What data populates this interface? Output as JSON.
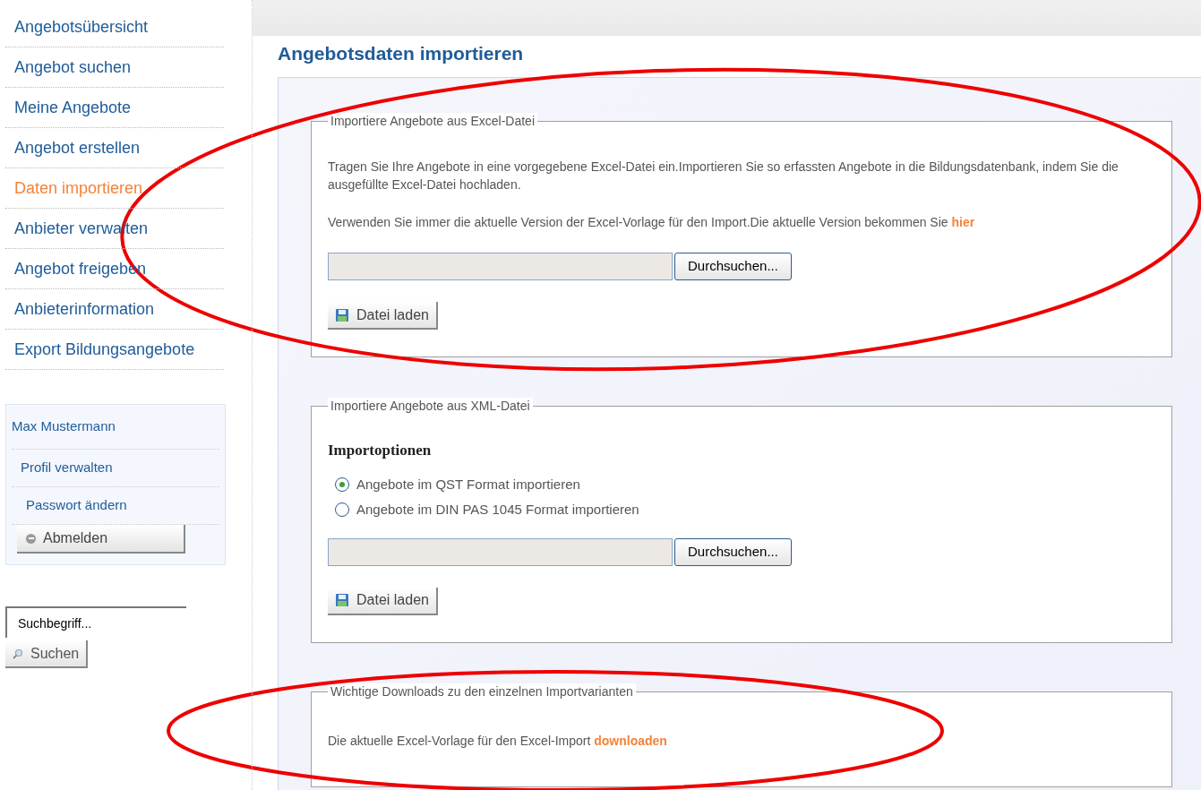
{
  "sidebar": {
    "nav": [
      {
        "label": "Angebotsübersicht",
        "selected": false
      },
      {
        "label": "Angebot suchen",
        "selected": false
      },
      {
        "label": "Meine Angebote",
        "selected": false
      },
      {
        "label": "Angebot erstellen",
        "selected": false
      },
      {
        "label": "Daten importieren",
        "selected": true
      },
      {
        "label": "Anbieter verwalten",
        "selected": false
      },
      {
        "label": "Angebot freigeben",
        "selected": false
      },
      {
        "label": "Anbieterinformation",
        "selected": false
      },
      {
        "label": "Export Bildungsangebote",
        "selected": false
      }
    ],
    "user_box": {
      "name": "Max Mustermann",
      "links": [
        "Profil verwalten",
        "Passwort ändern"
      ],
      "logout_button": "Abmelden"
    },
    "search": {
      "value": "Suchbegriff...",
      "button": "Suchen"
    }
  },
  "main": {
    "title": "Angebotsdaten importieren",
    "excel_import": {
      "legend": "Importiere Angebote aus Excel-Datei",
      "paragraph": "Tragen Sie Ihre Angebote in eine vorgegebene Excel-Datei ein.Importieren Sie so erfassten Angebote in die Bildungsdatenbank, indem Sie die ausgefüllte Excel-Datei hochladen.",
      "note": {
        "text": "Verwenden Sie immer die aktuelle Version der Excel-Vorlage für den Import.Die aktuelle Version bekommen Sie ",
        "link": "hier"
      },
      "browse_button": "Durchsuchen...",
      "load_button": "Datei laden"
    },
    "xml_import": {
      "legend": "Importiere Angebote aus XML-Datei",
      "heading": "Importoptionen",
      "options": [
        {
          "label": "Angebote im QST Format importieren",
          "selected": true
        },
        {
          "label": "Angebote im DIN PAS 1045 Format importieren",
          "selected": false
        }
      ],
      "browse_button": "Durchsuchen...",
      "load_button": "Datei laden"
    },
    "downloads": {
      "legend": "Wichtige Downloads zu den einzelnen Importvarianten",
      "text": "Die aktuelle Excel-Vorlage für den Excel-Import ",
      "link": "downloaden"
    }
  }
}
